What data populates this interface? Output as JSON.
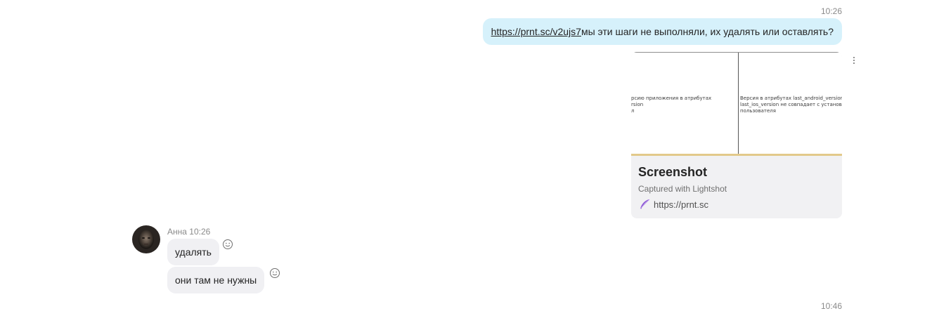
{
  "thread": {
    "top_timestamp": "10:26",
    "bottom_timestamp": "10:46"
  },
  "outgoing_message": {
    "link_text": "https://prnt.sc/v2ujs7",
    "text": " мы эти шаги не выполняли, их удалять или оставлять?",
    "preview": {
      "image_left_text": "рсию приложения в атрибутах\nrsion\nл",
      "image_right_text": "Версия в атрибутах last_android_version\nlast_ios_version не совпадает с установ\nпользователя",
      "title": "Screenshot",
      "subtitle": "Captured with Lightshot",
      "site": "https://prnt.sc"
    }
  },
  "incoming": {
    "sender_name": "Анна",
    "timestamp": "10:26",
    "messages": [
      {
        "text": "удалять"
      },
      {
        "text": "они там не нужны"
      }
    ]
  },
  "icons": {
    "message_options": "more-vertical-icon",
    "reaction": "smiley-icon",
    "lightshot": "feather-icon"
  },
  "colors": {
    "outgoing_bubble": "#d6f1fb",
    "incoming_bubble": "#f0f0f3",
    "lightshot_purple": "#8e5bd6"
  }
}
